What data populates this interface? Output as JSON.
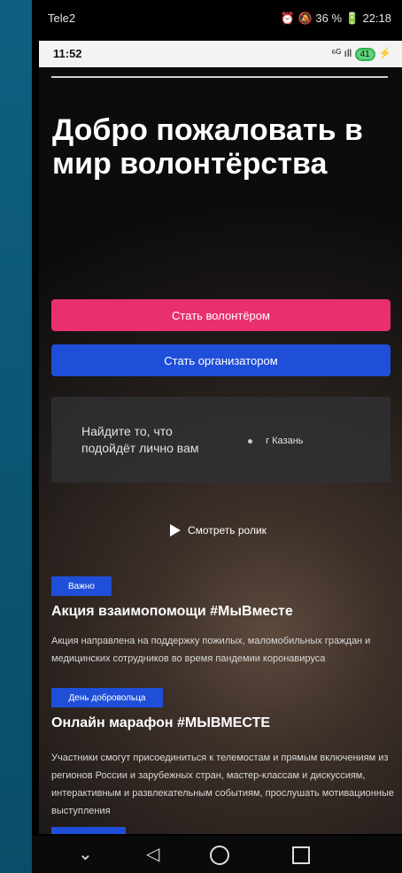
{
  "outer_status": {
    "carrier": "Tele2",
    "right": "⏰ 🔕 36 % 🔋 22:18"
  },
  "inner_status": {
    "time": "11:52",
    "icons": "⁶ᴳ ıll",
    "battery": "41"
  },
  "headline": "Добро пожаловать в мир волонтёрства",
  "buttons": {
    "volunteer": "Стать волонтёром",
    "organizer": "Стать организатором"
  },
  "finder": {
    "text": "Найдите то, что подойдёт лично вам",
    "city": "г Казань"
  },
  "video_label": "Смотреть ролик",
  "news": [
    {
      "badge": "Важно",
      "title": "Акция взаимопомощи #МыВместе",
      "text": "Акция направлена на поддержку пожилых, маломобильных граждан и медицинских сотрудников во время пандемии коронавируса"
    },
    {
      "badge": "День добровольца",
      "title": "Онлайн марафон #МЫВМЕСТЕ",
      "text": "Участники смогут присоединиться к телемостам и прямым включениям из регионов России и зарубежных стран, мастер-классам и дискуссиям, интерактивным и развлекательным событиям, прослушать мотивационные выступления"
    }
  ],
  "navbar": {
    "down": "⌄",
    "back": "◁"
  }
}
